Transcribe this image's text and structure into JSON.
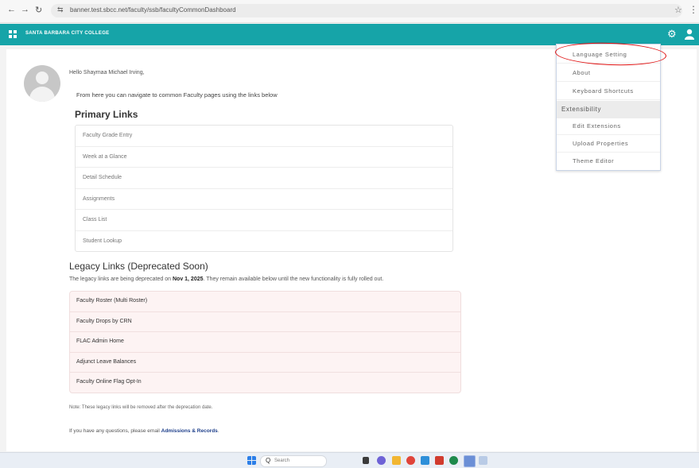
{
  "browser": {
    "url": "banner.test.sbcc.net/faculty/ssb/facultyCommonDashboard",
    "back_glyph": "←",
    "forward_glyph": "→",
    "reload_glyph": "↻",
    "site_glyph": "⇆",
    "star_glyph": "☆",
    "menu_glyph": "⋮"
  },
  "header": {
    "brand": "SANTA BARBARA CITY COLLEGE",
    "gear_glyph": "⚙",
    "accent_color": "#16a4a8"
  },
  "dashboard": {
    "greeting": "Hello Shaymaa Michael Irving,",
    "intro": "From here you can navigate to common Faculty pages using the links below",
    "primary_heading": "Primary Links",
    "primary_links": [
      "Faculty Grade Entry",
      "Week at a Glance",
      "Detail Schedule",
      "Assignments",
      "Class List",
      "Student Lookup"
    ],
    "legacy_heading": "Legacy Links (Deprecated Soon)",
    "legacy_note_prefix": "The legacy links are being deprecated on ",
    "legacy_date": "Nov 1, 2025",
    "legacy_note_suffix": ". They remain available below until the new functionality is fully rolled out.",
    "legacy_links": [
      "Faculty Roster (Multi Roster)",
      "Faculty Drops by CRN",
      "FLAC Admin Home",
      "Adjunct Leave Balances",
      "Faculty Online Flag Opt-In"
    ],
    "removed_note": "Note: These legacy links will be removed after the deprecation date.",
    "contact_prefix": "If you have any questions, please email ",
    "contact_link": "Admissions & Records",
    "contact_suffix": "."
  },
  "settings_menu": {
    "items": [
      "Language Setting",
      "About",
      "Keyboard Shortcuts"
    ],
    "section": "Extensibility",
    "section_items": [
      "Edit Extensions",
      "Upload Properties",
      "Theme Editor"
    ],
    "highlight_color": "#e01010"
  },
  "taskbar": {
    "search_placeholder": "Search",
    "search_glyph": "Q"
  }
}
